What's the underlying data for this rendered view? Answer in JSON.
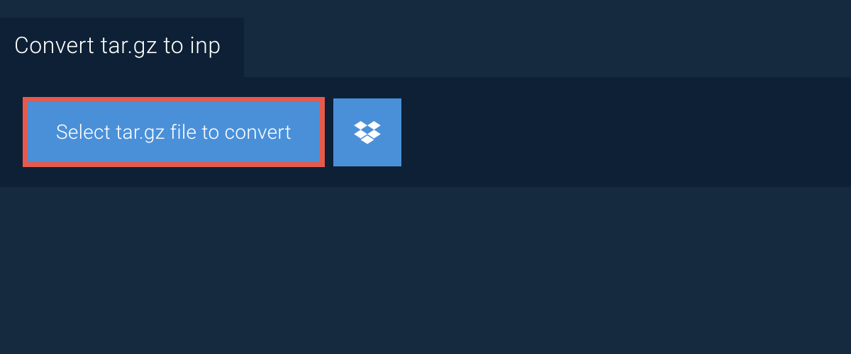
{
  "header": {
    "title": "Convert tar.gz to inp"
  },
  "actions": {
    "select_file_label": "Select tar.gz file to convert"
  },
  "colors": {
    "bg_outer": "#15293f",
    "bg_panel": "#0e2035",
    "button_bg": "#4a90d9",
    "button_border": "#e45a4c"
  }
}
